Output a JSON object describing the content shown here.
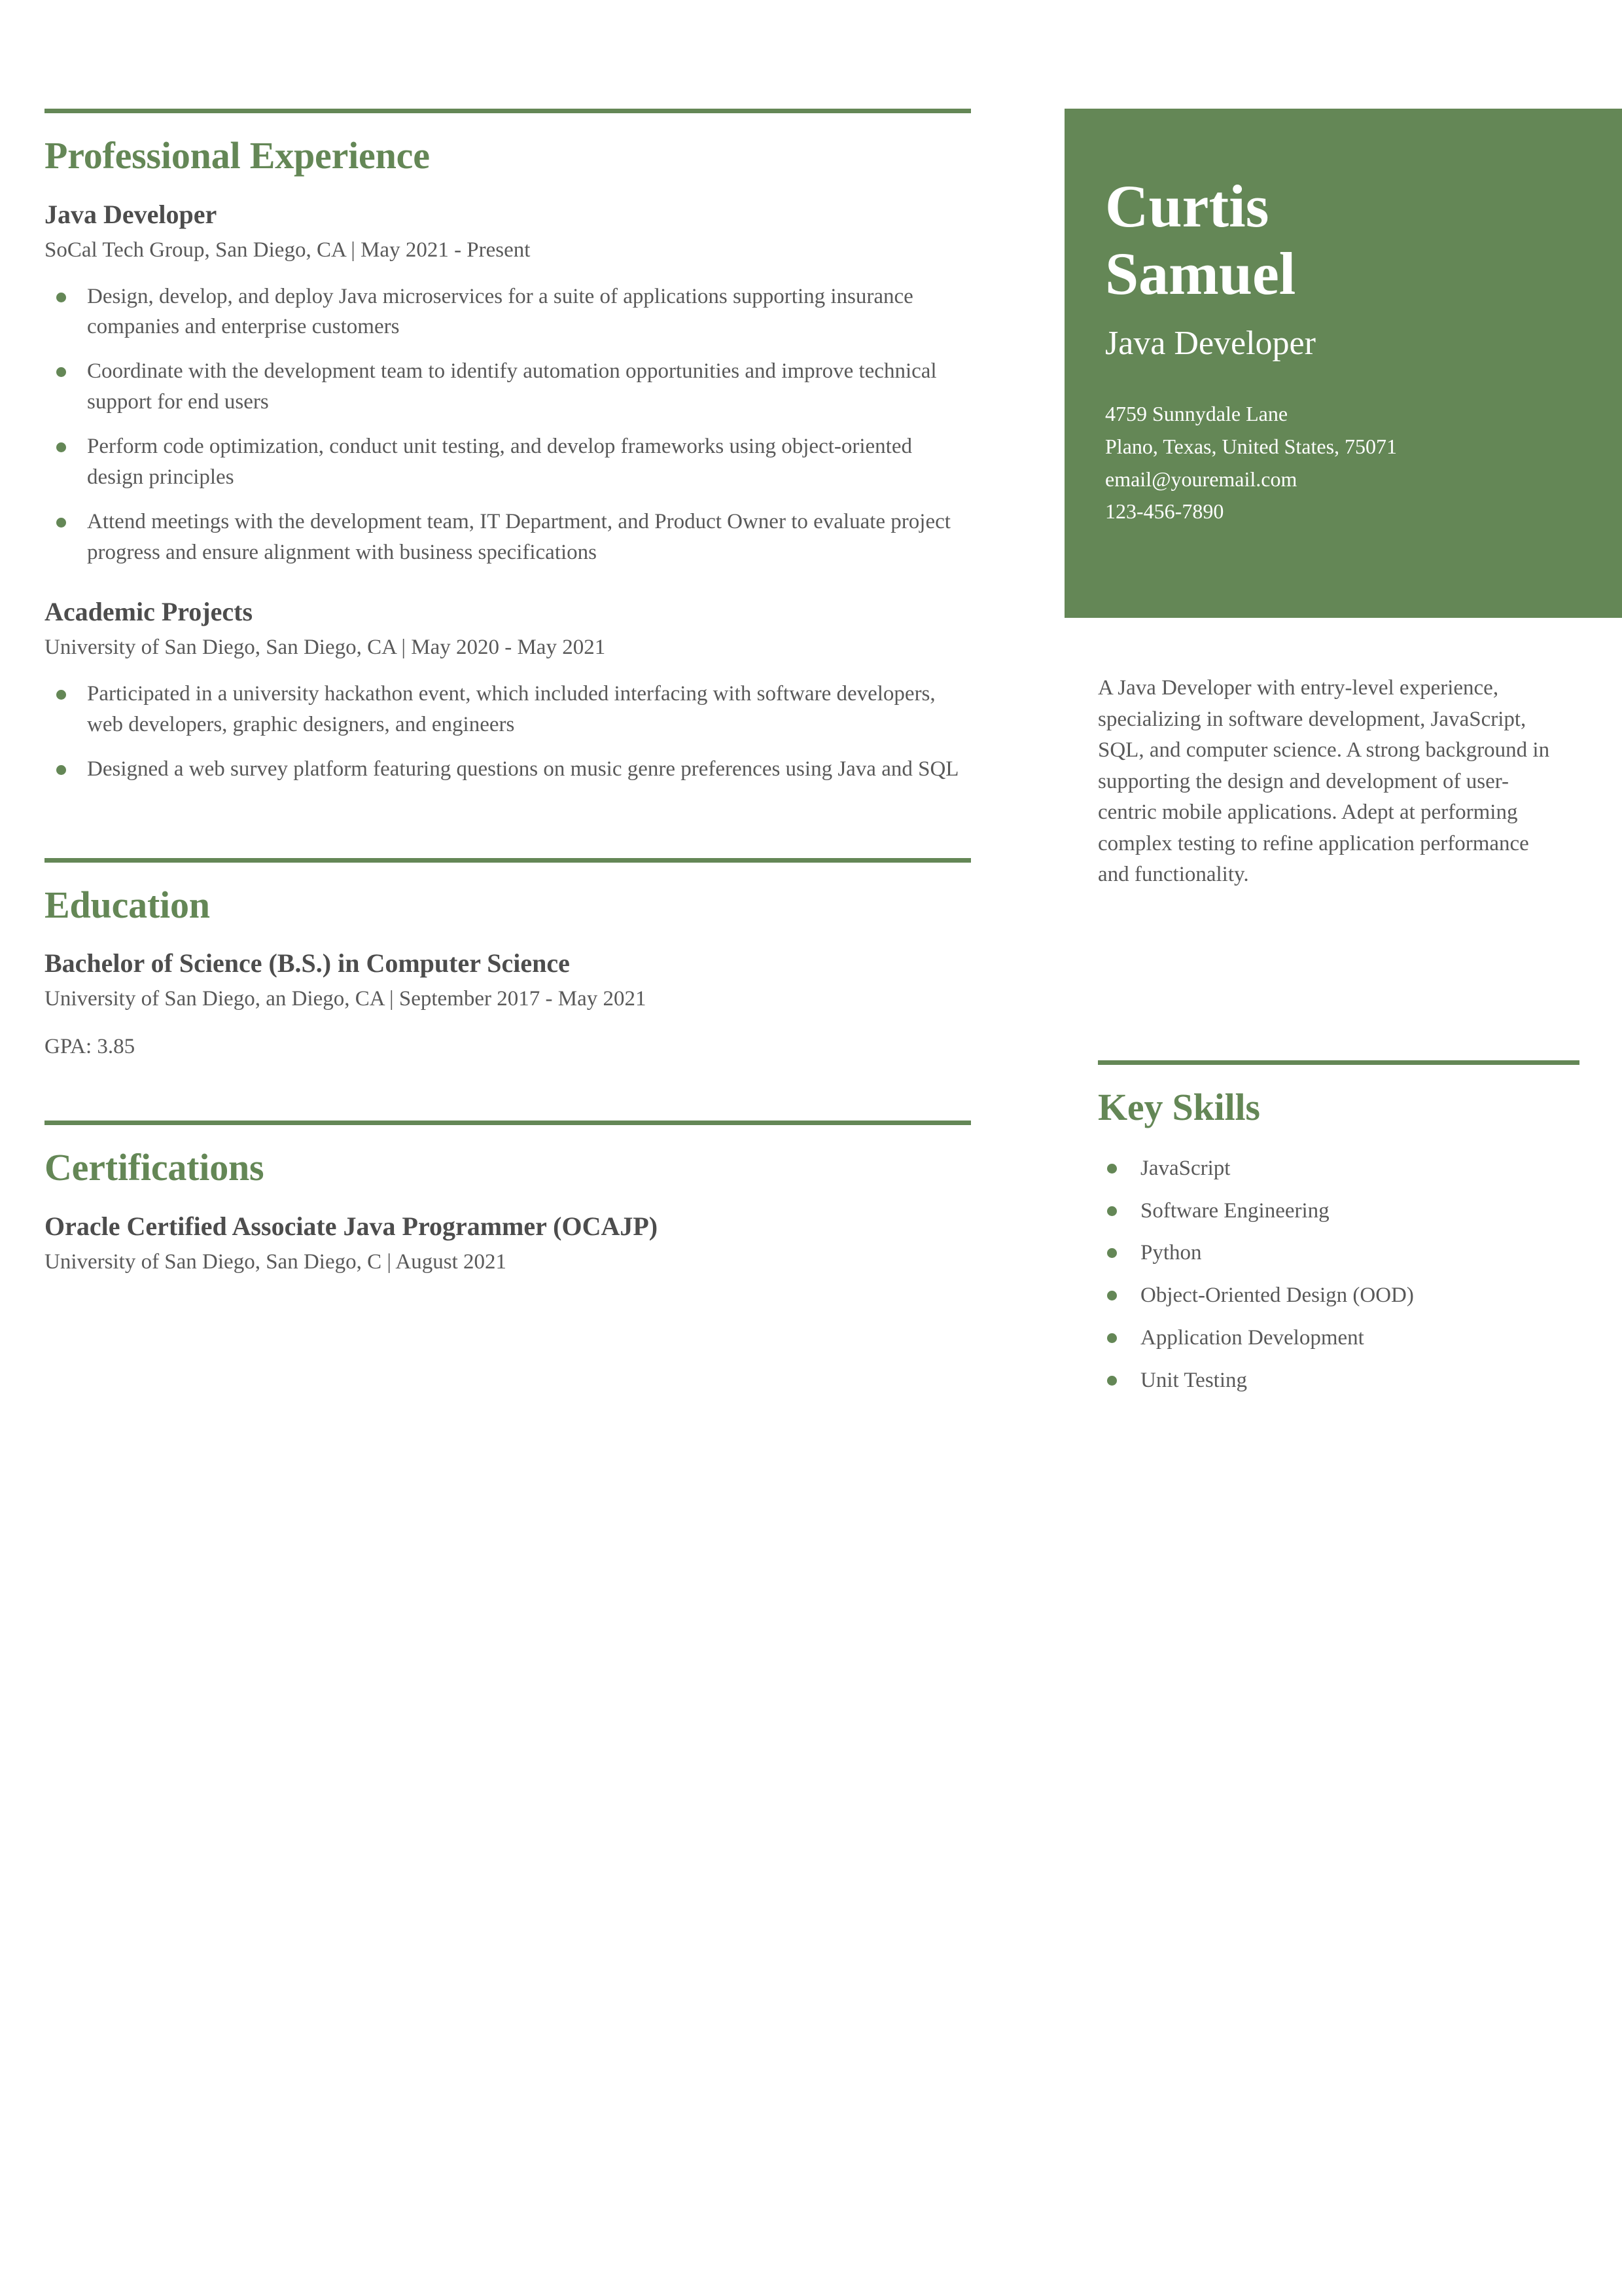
{
  "theme": {
    "accent_green": "#648756",
    "body_gray": "#595959",
    "heading_gray": "#4d4d4d",
    "header_text": "#ffffff",
    "page_background": "#ffffff"
  },
  "header": {
    "first_name": "Curtis",
    "last_name": "Samuel",
    "job_title": "Java Developer",
    "contact": {
      "street": "4759 Sunnydale Lane",
      "city_state_zip": "Plano, Texas, United States, 75071",
      "email": "email@youremail.com",
      "phone": "123-456-7890"
    }
  },
  "summary": {
    "text": "A Java Developer with entry-level experience, specializing in software development, JavaScript, SQL, and computer science. A strong background in supporting the design and development of user-centric mobile applications. Adept at performing complex testing to refine application performance and functionality."
  },
  "key_skills": {
    "heading": "Key Skills",
    "items": [
      "JavaScript",
      "Software Engineering",
      "Python",
      "Object-Oriented Design (OOD)",
      "Application Development",
      "Unit Testing"
    ]
  },
  "professional_experience": {
    "heading": "Professional Experience",
    "entries": [
      {
        "title": "Java Developer",
        "subtitle": "SoCal Tech Group, San Diego, CA | May 2021 - Present",
        "bullets": [
          "Design, develop, and deploy Java microservices for a suite of applications supporting insurance companies and enterprise customers",
          "Coordinate with the development team to identify automation opportunities and improve technical support for end users",
          "Perform code optimization, conduct unit testing, and develop frameworks using object-oriented design principles",
          "Attend meetings with the development team, IT Department, and Product Owner to evaluate project progress and ensure alignment with business specifications"
        ]
      },
      {
        "title": "Academic Projects",
        "subtitle": "University of San Diego, San Diego, CA | May 2020 - May 2021",
        "bullets": [
          "Participated in a university hackathon event, which included interfacing with software developers, web developers, graphic designers, and engineers",
          "Designed a web survey platform featuring questions on music genre preferences using Java and SQL"
        ]
      }
    ]
  },
  "education": {
    "heading": "Education",
    "degree": "Bachelor of Science (B.S.) in Computer Science",
    "school": "University of San Diego, an Diego, CA | September 2017 - May 2021",
    "gpa": "GPA: 3.85"
  },
  "certifications": {
    "heading": "Certifications",
    "title": "Oracle Certified Associate Java Programmer (OCAJP)",
    "subtitle": "University of San Diego, San Diego, C | August 2021"
  }
}
